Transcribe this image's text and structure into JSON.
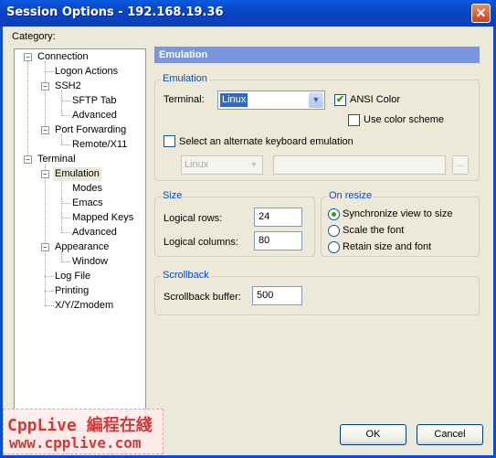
{
  "window": {
    "title": "Session Options - 192.168.19.36"
  },
  "category_label": "Category:",
  "tree": [
    {
      "label": "Connection"
    },
    {
      "label": "Logon Actions"
    },
    {
      "label": "SSH2"
    },
    {
      "label": "SFTP Tab"
    },
    {
      "label": "Advanced"
    },
    {
      "label": "Port Forwarding"
    },
    {
      "label": "Remote/X11"
    },
    {
      "label": "Terminal"
    },
    {
      "label": "Emulation"
    },
    {
      "label": "Modes"
    },
    {
      "label": "Emacs"
    },
    {
      "label": "Mapped Keys"
    },
    {
      "label": "Advanced"
    },
    {
      "label": "Appearance"
    },
    {
      "label": "Window"
    },
    {
      "label": "Log File"
    },
    {
      "label": "Printing"
    },
    {
      "label": "X/Y/Zmodem"
    }
  ],
  "panel_title": "Emulation",
  "emulation": {
    "group_title": "Emulation",
    "terminal_label": "Terminal:",
    "terminal_value": "Linux",
    "ansi_color_label": "ANSI Color",
    "ansi_color_checked": true,
    "use_color_scheme_label": "Use color scheme",
    "use_color_scheme_checked": false,
    "alt_keyboard_label": "Select an alternate keyboard emulation",
    "alt_keyboard_checked": false,
    "alt_keyboard_value": "Linux",
    "browse_label": "..."
  },
  "size": {
    "group_title": "Size",
    "rows_label": "Logical rows:",
    "rows_value": "24",
    "columns_label": "Logical columns:",
    "columns_value": "80"
  },
  "on_resize": {
    "group_title": "On resize",
    "options": [
      "Synchronize view to size",
      "Scale the font",
      "Retain size and font"
    ],
    "selected_index": 0
  },
  "scrollback": {
    "group_title": "Scrollback",
    "buffer_label": "Scrollback buffer:",
    "buffer_value": "500"
  },
  "buttons": {
    "ok": "OK",
    "cancel": "Cancel"
  },
  "watermark": {
    "line1": "CppLive 編程在綫",
    "line2": "www.cpplive.com"
  }
}
